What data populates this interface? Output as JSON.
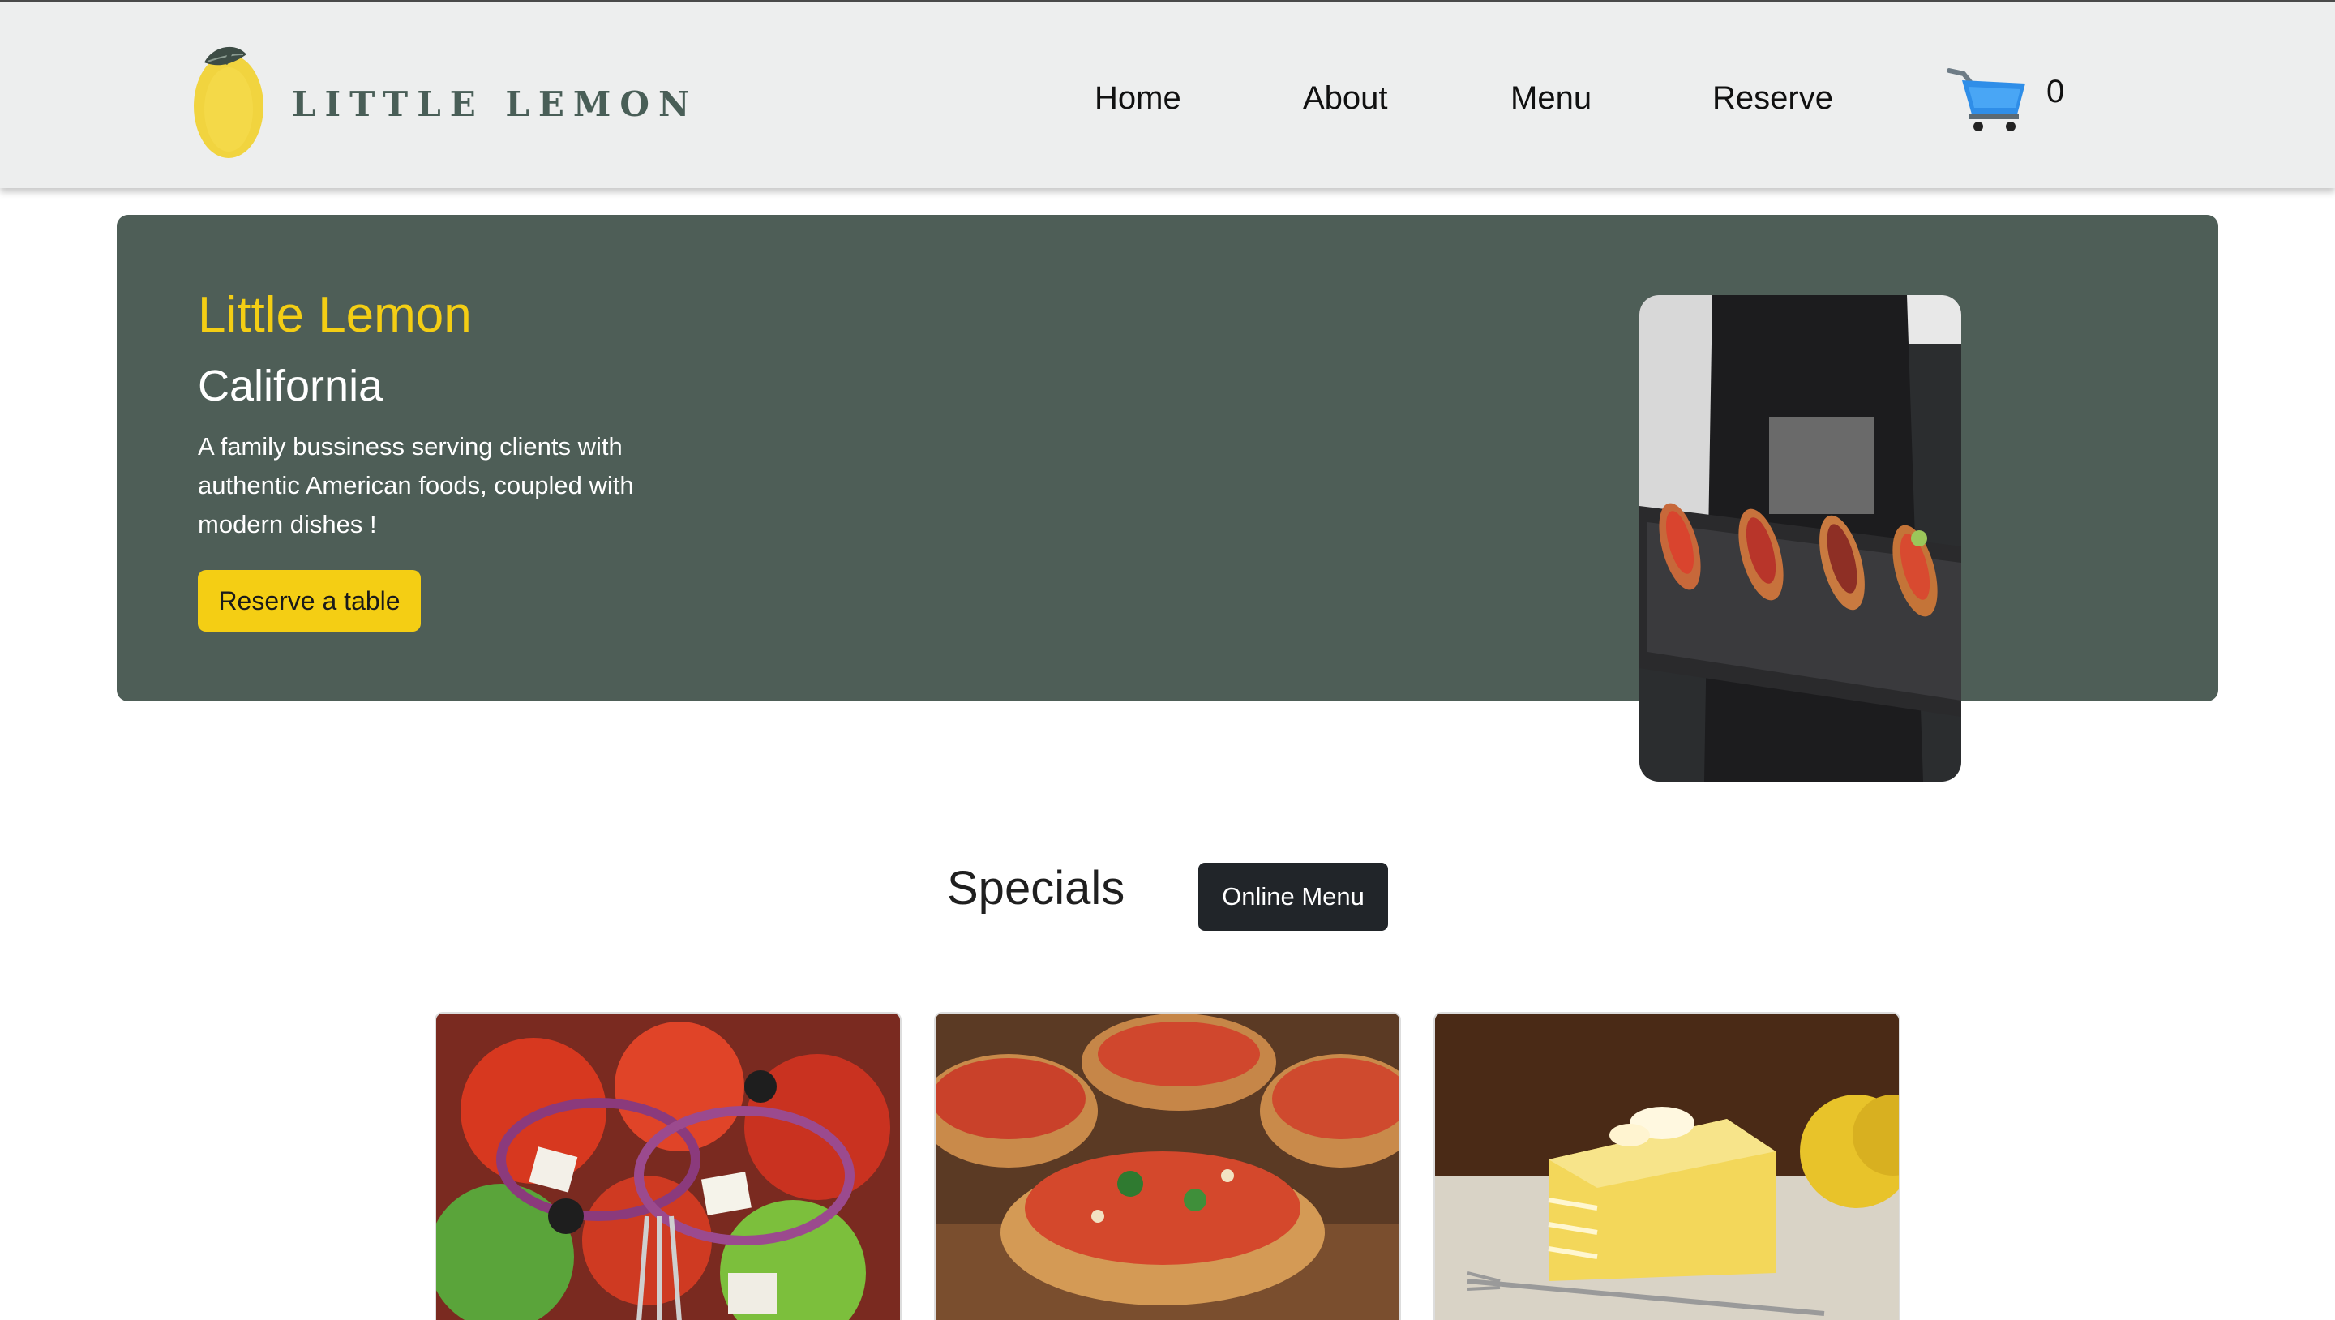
{
  "brand": {
    "logo_text": "LITTLE LEMON",
    "primary_color": "#495e57",
    "accent_color": "#f4ce14"
  },
  "nav": {
    "items": [
      "Home",
      "About",
      "Menu",
      "Reserve"
    ]
  },
  "cart": {
    "icon": "shopping-cart-icon",
    "count": "0"
  },
  "hero": {
    "title": "Little Lemon",
    "subtitle": "California",
    "description": "A family bussiness serving clients with authentic American foods, coupled with modern dishes !",
    "button_label": "Reserve a table",
    "image": "waiter-serving-bruschetta-photo"
  },
  "specials": {
    "title": "Specials",
    "menu_button_label": "Online Menu",
    "cards": [
      {
        "image": "greek-salad-photo"
      },
      {
        "image": "bruschetta-photo"
      },
      {
        "image": "lemon-dessert-photo"
      }
    ]
  }
}
